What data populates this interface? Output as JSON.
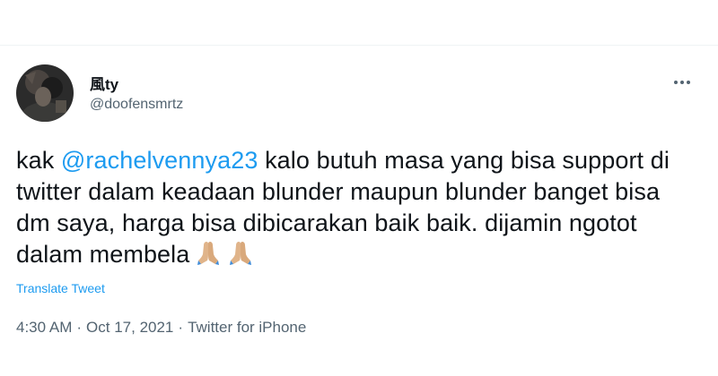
{
  "author": {
    "display_name": "風ty",
    "handle": "@doofensmrtz",
    "avatar_icon": "profile-photo"
  },
  "more_icon": "more-horizontal-icon",
  "tweet": {
    "prefix": "kak ",
    "mention": "@rachelvennya23",
    "text": " kalo butuh masa yang bisa support di twitter dalam keadaan blunder maupun blunder banget bisa dm saya, harga bisa dibicarakan baik baik. dijamin ngotot dalam membela",
    "emojis": [
      "🙏🏼",
      "🙏🏼"
    ]
  },
  "translate_label": "Translate Tweet",
  "meta": {
    "time": "4:30 AM",
    "separator": "·",
    "date": "Oct 17, 2021",
    "source": "Twitter for iPhone"
  },
  "colors": {
    "link": "#1d9bf0",
    "secondary_text": "#536471",
    "primary_text": "#0f1419"
  }
}
